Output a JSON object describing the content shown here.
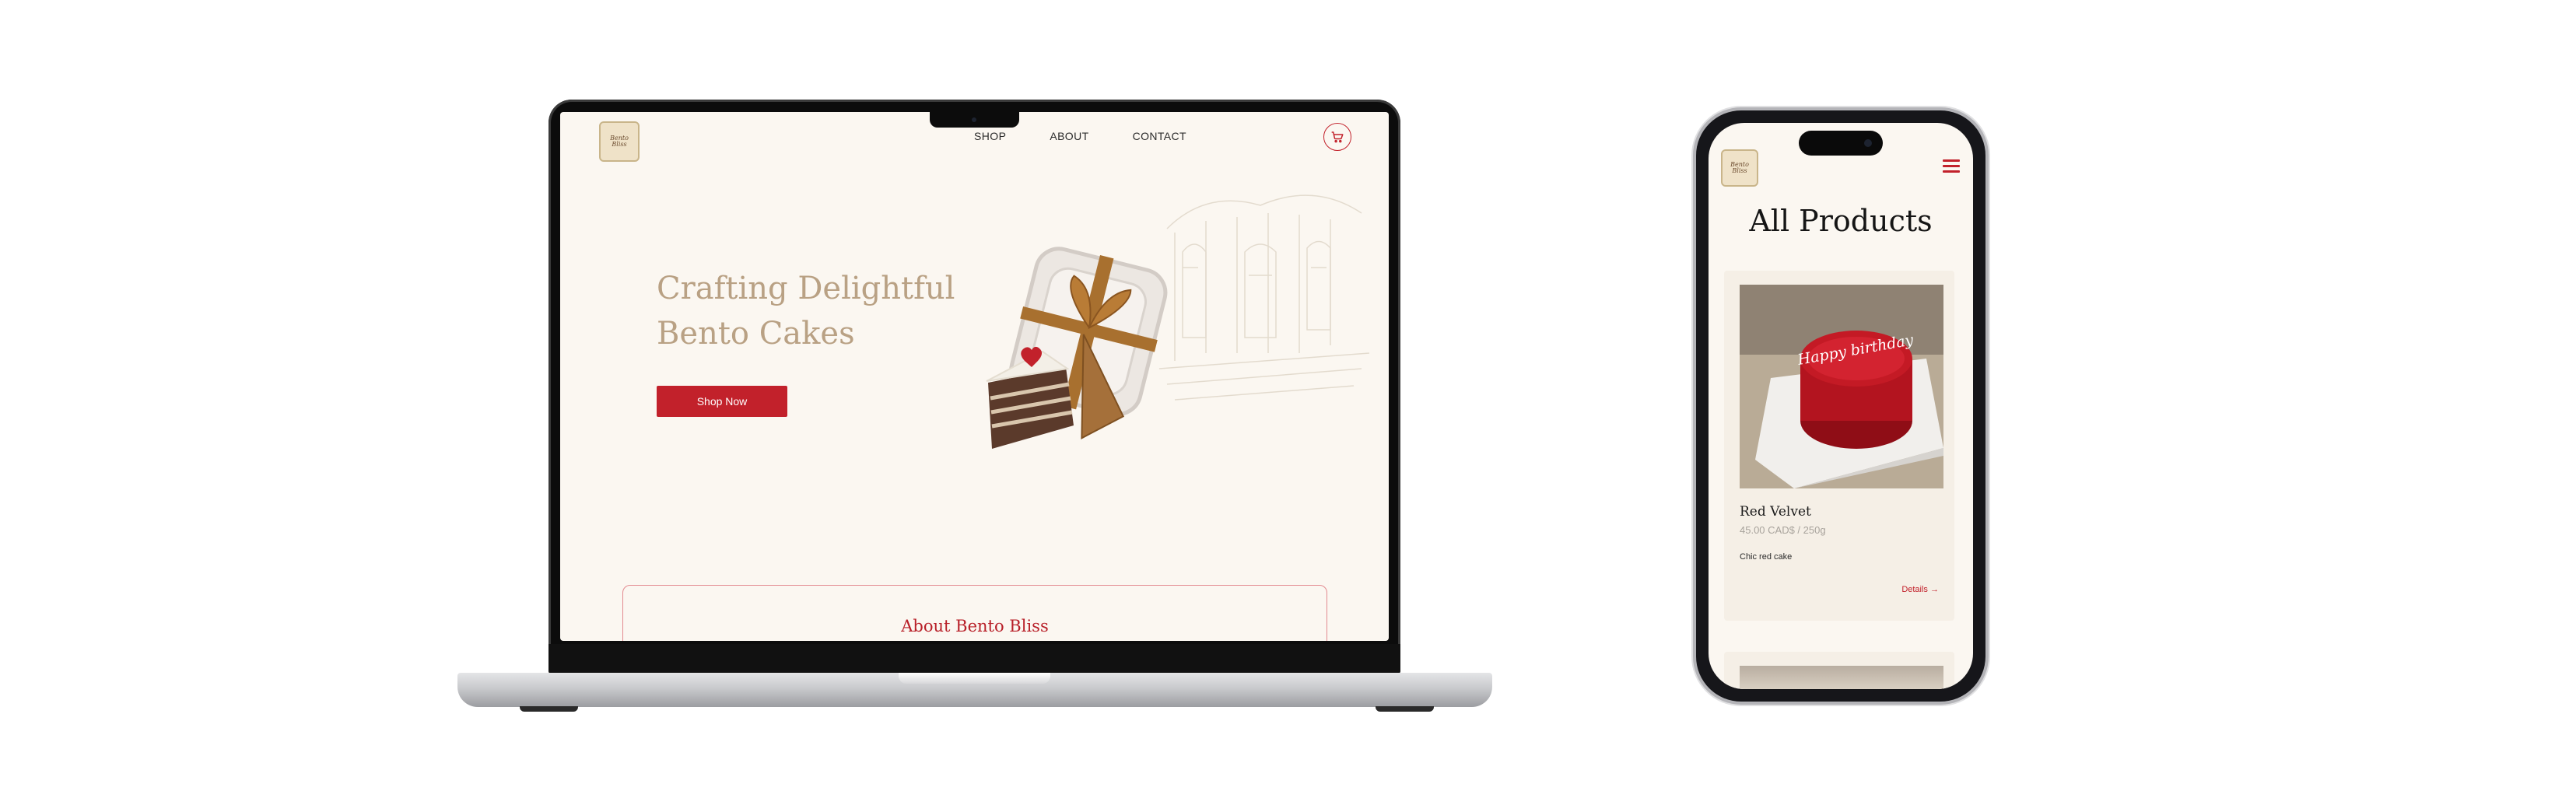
{
  "colors": {
    "accent": "#c2212b",
    "cream": "#fbf7f1",
    "hero_text": "#b9a184",
    "card_bg": "#f5efe6"
  },
  "desktop": {
    "logo": {
      "line1": "Bento",
      "line2": "Bliss"
    },
    "nav": {
      "items": [
        "SHOP",
        "ABOUT",
        "CONTACT"
      ],
      "cart_icon": "shopping-cart-icon"
    },
    "hero": {
      "line1": "Crafting Delightful",
      "line2": "Bento Cakes",
      "cta": "Shop Now"
    },
    "about": {
      "title": "About Bento Bliss"
    }
  },
  "mobile": {
    "logo": {
      "line1": "Bento",
      "line2": "Bliss"
    },
    "menu_icon": "hamburger-menu-icon",
    "heading": "All Products",
    "product": {
      "cake_text": "Happy birthday",
      "name": "Red Velvet",
      "price": "45.00 CAD$ / 250g",
      "description": "Chic red cake",
      "details": "Details →"
    }
  }
}
